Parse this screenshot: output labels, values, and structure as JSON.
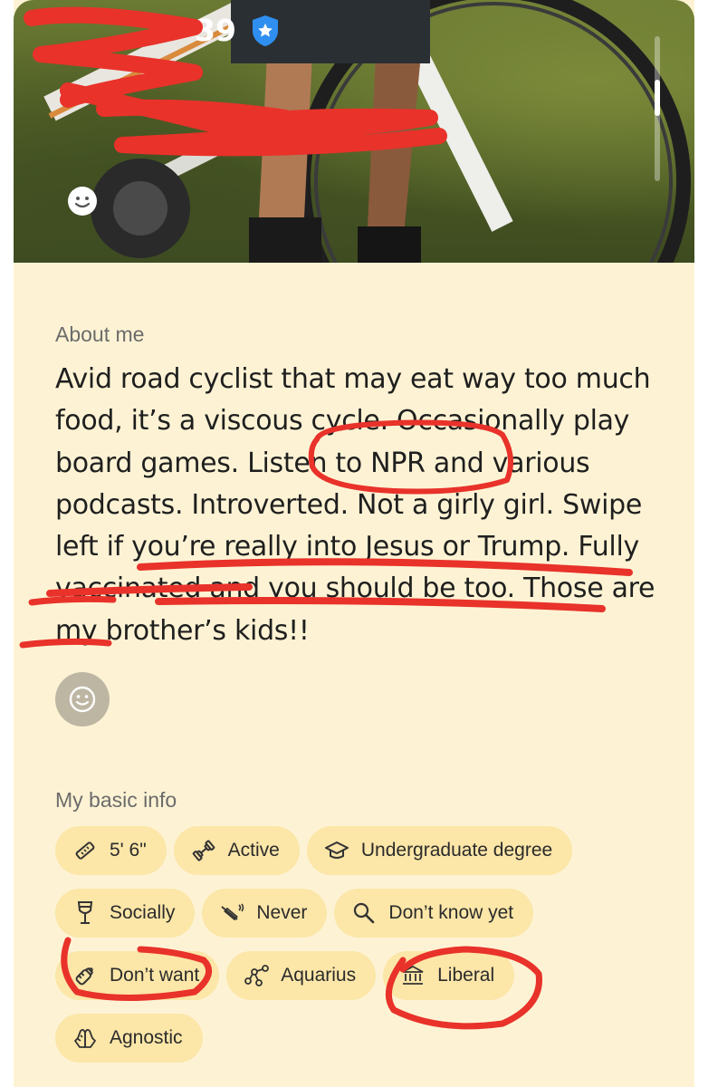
{
  "profile": {
    "age_text": "39"
  },
  "about": {
    "heading": "About me",
    "bio": "Avid road cyclist that may eat way too much food, it’s a viscous cycle. Occasionally play board games. Listen to NPR and various podcasts. Introverted. Not a girly girl. Swipe left if you’re really into Jesus or Trump. Fully vaccinated and you should be too. Those are my brother’s kids!!"
  },
  "basic_info": {
    "heading": "My basic info",
    "chips": [
      {
        "icon": "ruler-icon",
        "label": "5' 6\""
      },
      {
        "icon": "dumbbell-icon",
        "label": "Active"
      },
      {
        "icon": "graduation-cap-icon",
        "label": "Undergraduate degree"
      },
      {
        "icon": "wine-glass-icon",
        "label": "Socially"
      },
      {
        "icon": "no-smoking-icon",
        "label": "Never"
      },
      {
        "icon": "magnifier-icon",
        "label": "Don’t know yet"
      },
      {
        "icon": "baby-bottle-icon",
        "label": "Don’t want"
      },
      {
        "icon": "zodiac-constellation-icon",
        "label": "Aquarius"
      },
      {
        "icon": "government-building-icon",
        "label": "Liberal"
      },
      {
        "icon": "praying-hands-icon",
        "label": "Agnostic"
      }
    ]
  },
  "colors": {
    "card_background": "#fdf3d4",
    "chip_background": "#fce6a8",
    "verified_badge": "#2f8ff0",
    "annotation_red": "#e8322a"
  }
}
